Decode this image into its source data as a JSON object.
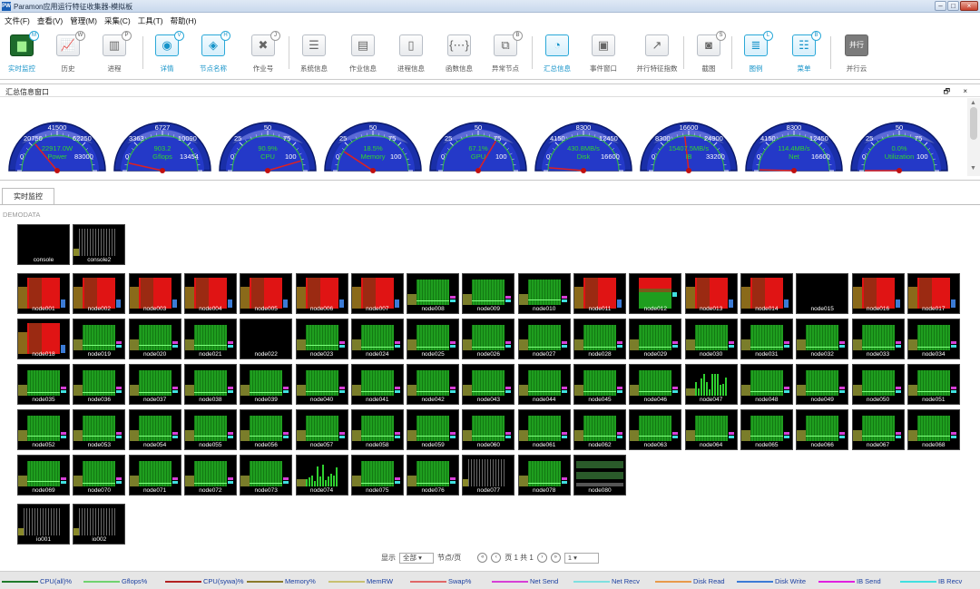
{
  "window": {
    "title": "Paramon应用运行特征收集器-模拟板",
    "icon_text": "PW"
  },
  "menu": [
    "文件(F)",
    "查看(V)",
    "管理(M)",
    "采集(C)",
    "工具(T)",
    "帮助(H)"
  ],
  "toolbar": [
    {
      "label": "实时监控",
      "badge": "M",
      "icon": "monitor-icon",
      "glyph": "▆",
      "active": true
    },
    {
      "label": "历史",
      "badge": "W",
      "icon": "history-chart-icon",
      "glyph": "📈",
      "active": false
    },
    {
      "label": "进程",
      "badge": "P",
      "icon": "process-chart-icon",
      "glyph": "▥",
      "active": false
    },
    {
      "label": "详情",
      "badge": "V",
      "icon": "eye-icon",
      "glyph": "◉",
      "active": true
    },
    {
      "label": "节点名称",
      "badge": "H",
      "icon": "tag-icon",
      "glyph": "◈",
      "active": true
    },
    {
      "label": "作业号",
      "badge": "J",
      "icon": "puzzle-icon",
      "glyph": "✖",
      "active": false
    },
    {
      "label": "系统信息",
      "badge": "",
      "icon": "list-icon",
      "glyph": "☰",
      "active": false
    },
    {
      "label": "作业信息",
      "badge": "",
      "icon": "grid-icon",
      "glyph": "▤",
      "active": false
    },
    {
      "label": "进程信息",
      "badge": "",
      "icon": "columns-icon",
      "glyph": "▯",
      "active": false
    },
    {
      "label": "函数信息",
      "badge": "",
      "icon": "braces-icon",
      "glyph": "{⋯}",
      "active": false
    },
    {
      "label": "异常节点",
      "badge": "B",
      "icon": "warning-node-icon",
      "glyph": "⧉",
      "active": false
    },
    {
      "label": "汇总信息",
      "badge": "",
      "icon": "gauge-icon",
      "glyph": "◔",
      "active": true
    },
    {
      "label": "事件窗口",
      "badge": "",
      "icon": "event-window-icon",
      "glyph": "▣",
      "active": false
    },
    {
      "label": "并行特征指数",
      "badge": "",
      "icon": "trend-icon",
      "glyph": "↗",
      "active": false
    },
    {
      "label": "截图",
      "badge": "S",
      "icon": "camera-icon",
      "glyph": "◙",
      "active": false
    },
    {
      "label": "图例",
      "badge": "L",
      "icon": "legend-icon",
      "glyph": "≣",
      "active": true
    },
    {
      "label": "菜单",
      "badge": "B",
      "icon": "menu-list-icon",
      "glyph": "☷",
      "active": true
    },
    {
      "label": "并行云",
      "badge": "",
      "icon": "parallel-cloud-icon",
      "glyph": "并行",
      "active": false
    }
  ],
  "summary_panel": {
    "title": "汇总信息窗口",
    "buttons": "🗗 ×"
  },
  "gauges": [
    {
      "top": "41500",
      "left": "20750",
      "right": "62250",
      "value": "22917.0W",
      "name": "Power",
      "min": "0",
      "max": "83000",
      "fraction": 0.28
    },
    {
      "top": "6727",
      "left": "3363",
      "right": "10090",
      "value": "903.2",
      "name": "Gflops",
      "min": "0",
      "max": "13454",
      "fraction": 0.07
    },
    {
      "top": "50",
      "left": "25",
      "right": "75",
      "value": "90.9%",
      "name": "CPU",
      "min": "0",
      "max": "100",
      "fraction": 0.909
    },
    {
      "top": "50",
      "left": "25",
      "right": "75",
      "value": "18.5%",
      "name": "Memory",
      "min": "0",
      "max": "100",
      "fraction": 0.185
    },
    {
      "top": "50",
      "left": "25",
      "right": "75",
      "value": "67.1%",
      "name": "GPU",
      "min": "0",
      "max": "100",
      "fraction": 0.671
    },
    {
      "top": "8300",
      "left": "4150",
      "right": "12450",
      "value": "430.8MB/s",
      "name": "Disk",
      "min": "0",
      "max": "16600",
      "fraction": 0.026
    },
    {
      "top": "16600",
      "left": "8300",
      "right": "24900",
      "value": "15407.5MB/s",
      "name": "IB",
      "min": "0",
      "max": "33200",
      "fraction": 0.464
    },
    {
      "top": "8300",
      "left": "4150",
      "right": "12450",
      "value": "114.4MB/s",
      "name": "Net",
      "min": "0",
      "max": "16600",
      "fraction": 0.007
    },
    {
      "top": "50",
      "left": "25",
      "right": "75",
      "value": "0.0%",
      "name": "Utilization",
      "min": "0",
      "max": "100",
      "fraction": 0.0
    }
  ],
  "tab": {
    "label": "实时监控"
  },
  "demodata_label": "DEMODATA",
  "nodes": [
    {
      "name": "console",
      "kind": "black"
    },
    {
      "name": "console2",
      "kind": "gray"
    },
    {
      "name": "node001",
      "kind": "red"
    },
    {
      "name": "node002",
      "kind": "red"
    },
    {
      "name": "node003",
      "kind": "red"
    },
    {
      "name": "node004",
      "kind": "red"
    },
    {
      "name": "node005",
      "kind": "red"
    },
    {
      "name": "node006",
      "kind": "red"
    },
    {
      "name": "node007",
      "kind": "red"
    },
    {
      "name": "node008",
      "kind": "green"
    },
    {
      "name": "node009",
      "kind": "green"
    },
    {
      "name": "node010",
      "kind": "green"
    },
    {
      "name": "node011",
      "kind": "red"
    },
    {
      "name": "node012",
      "kind": "mixed"
    },
    {
      "name": "node013",
      "kind": "red"
    },
    {
      "name": "node014",
      "kind": "red"
    },
    {
      "name": "node015",
      "kind": "black"
    },
    {
      "name": "node016",
      "kind": "red"
    },
    {
      "name": "node017",
      "kind": "red"
    },
    {
      "name": "node018",
      "kind": "red"
    },
    {
      "name": "node019",
      "kind": "green"
    },
    {
      "name": "node020",
      "kind": "green"
    },
    {
      "name": "node021",
      "kind": "green"
    },
    {
      "name": "node022",
      "kind": "black"
    },
    {
      "name": "node023",
      "kind": "green"
    },
    {
      "name": "node024",
      "kind": "green"
    },
    {
      "name": "node025",
      "kind": "green"
    },
    {
      "name": "node026",
      "kind": "green"
    },
    {
      "name": "node027",
      "kind": "green"
    },
    {
      "name": "node028",
      "kind": "green"
    },
    {
      "name": "node029",
      "kind": "green"
    },
    {
      "name": "node030",
      "kind": "green"
    },
    {
      "name": "node031",
      "kind": "green"
    },
    {
      "name": "node032",
      "kind": "green"
    },
    {
      "name": "node033",
      "kind": "green"
    },
    {
      "name": "node034",
      "kind": "green"
    },
    {
      "name": "node035",
      "kind": "green"
    },
    {
      "name": "node036",
      "kind": "green"
    },
    {
      "name": "node037",
      "kind": "green"
    },
    {
      "name": "node038",
      "kind": "green"
    },
    {
      "name": "node039",
      "kind": "green"
    },
    {
      "name": "node040",
      "kind": "green"
    },
    {
      "name": "node041",
      "kind": "green"
    },
    {
      "name": "node042",
      "kind": "green"
    },
    {
      "name": "node043",
      "kind": "green"
    },
    {
      "name": "node044",
      "kind": "green"
    },
    {
      "name": "node045",
      "kind": "green"
    },
    {
      "name": "node046",
      "kind": "green"
    },
    {
      "name": "node047",
      "kind": "sparse"
    },
    {
      "name": "node048",
      "kind": "green"
    },
    {
      "name": "node049",
      "kind": "green"
    },
    {
      "name": "node050",
      "kind": "green"
    },
    {
      "name": "node051",
      "kind": "green"
    },
    {
      "name": "node052",
      "kind": "green"
    },
    {
      "name": "node053",
      "kind": "green"
    },
    {
      "name": "node054",
      "kind": "green"
    },
    {
      "name": "node055",
      "kind": "green"
    },
    {
      "name": "node056",
      "kind": "green"
    },
    {
      "name": "node057",
      "kind": "green"
    },
    {
      "name": "node058",
      "kind": "green"
    },
    {
      "name": "node059",
      "kind": "green"
    },
    {
      "name": "node060",
      "kind": "green"
    },
    {
      "name": "node061",
      "kind": "green"
    },
    {
      "name": "node062",
      "kind": "green"
    },
    {
      "name": "node063",
      "kind": "green"
    },
    {
      "name": "node064",
      "kind": "green"
    },
    {
      "name": "node065",
      "kind": "green"
    },
    {
      "name": "node066",
      "kind": "green"
    },
    {
      "name": "node067",
      "kind": "green"
    },
    {
      "name": "node068",
      "kind": "green"
    },
    {
      "name": "node069",
      "kind": "green"
    },
    {
      "name": "node070",
      "kind": "green"
    },
    {
      "name": "node071",
      "kind": "green"
    },
    {
      "name": "node072",
      "kind": "green"
    },
    {
      "name": "node073",
      "kind": "green"
    },
    {
      "name": "node074",
      "kind": "sparse"
    },
    {
      "name": "node075",
      "kind": "green"
    },
    {
      "name": "node076",
      "kind": "green"
    },
    {
      "name": "node077",
      "kind": "gray"
    },
    {
      "name": "node078",
      "kind": "green"
    },
    {
      "name": "node080",
      "kind": "bands"
    },
    {
      "name": "io001",
      "kind": "gray"
    },
    {
      "name": "io002",
      "kind": "gray"
    }
  ],
  "pager": {
    "show_label": "显示",
    "per_page_value": "全部",
    "per_page_unit": "节点/页",
    "page_text": "页 1 共 1",
    "page_value": "1"
  },
  "legend": [
    {
      "label": "CPU(all)%",
      "color": "#1e7a2a"
    },
    {
      "label": "Gflops%",
      "color": "#6fd36f"
    },
    {
      "label": "CPU(sywa)%",
      "color": "#b22222"
    },
    {
      "label": "Memory%",
      "color": "#8a7a2a"
    },
    {
      "label": "MemRW",
      "color": "#c8c070"
    },
    {
      "label": "Swap%",
      "color": "#e06868"
    },
    {
      "label": "Net Send",
      "color": "#d63fd6"
    },
    {
      "label": "Net Recv",
      "color": "#7ee0e0"
    },
    {
      "label": "Disk Read",
      "color": "#e89a4a"
    },
    {
      "label": "Disk Write",
      "color": "#3b7bd6"
    },
    {
      "label": "IB Send",
      "color": "#e020e0"
    },
    {
      "label": "IB Recv",
      "color": "#40e0e0"
    }
  ]
}
